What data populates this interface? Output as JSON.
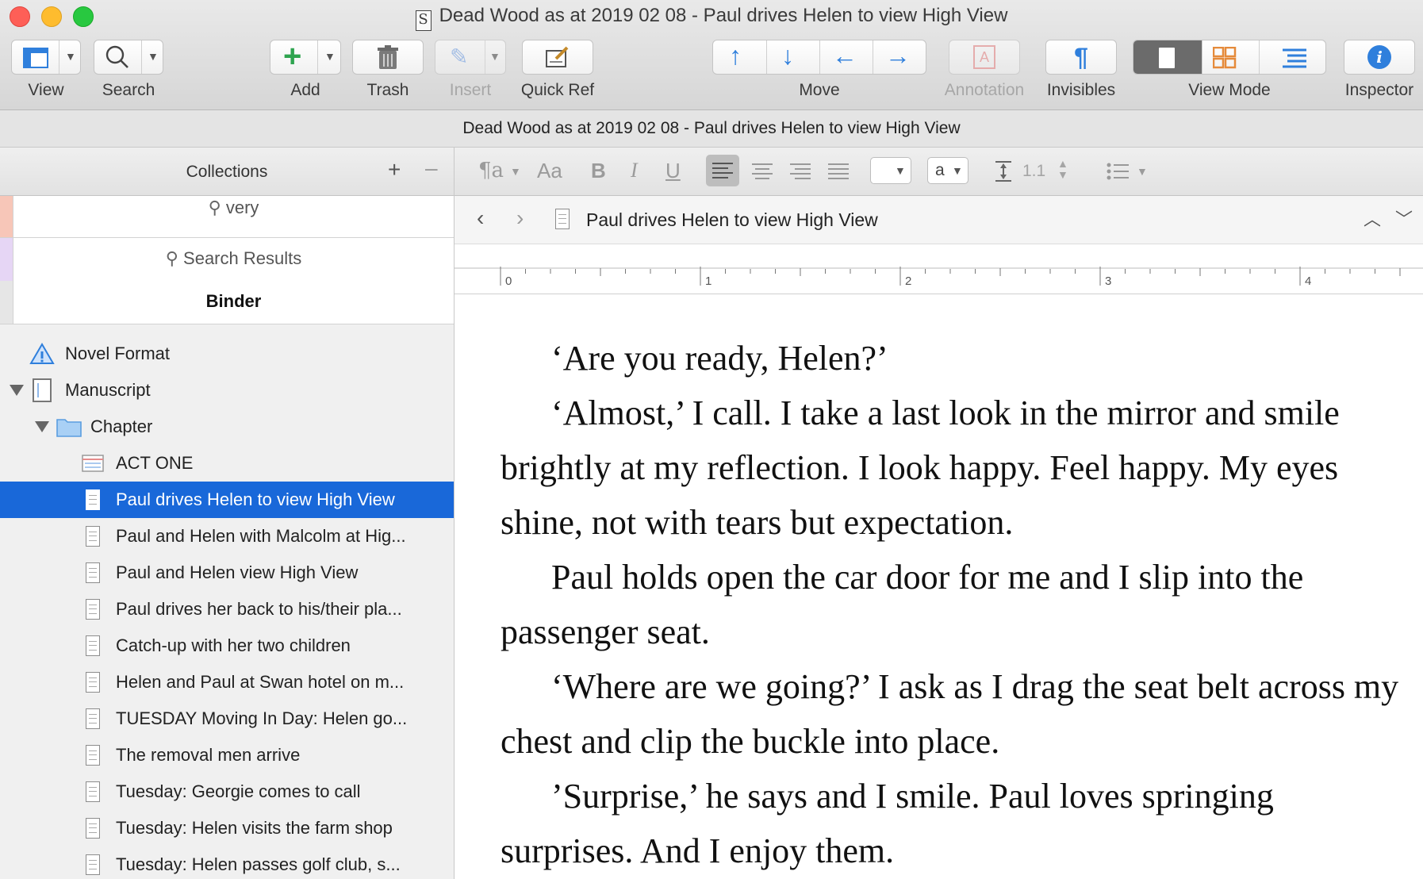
{
  "window": {
    "title": "Dead Wood as at 2019 02 08 - Paul drives Helen to view High View"
  },
  "toolbar": {
    "view": "View",
    "search": "Search",
    "add": "Add",
    "trash": "Trash",
    "insert": "Insert",
    "quick_ref": "Quick Ref",
    "move": "Move",
    "annotation": "Annotation",
    "invisibles": "Invisibles",
    "view_mode": "View Mode",
    "inspector": "Inspector"
  },
  "pathbar": {
    "text": "Dead Wood as at 2019 02 08 - Paul drives Helen to view High View"
  },
  "sidebar": {
    "collections_title": "Collections",
    "collections": [
      {
        "label": "very",
        "color": "#f7c6b8"
      },
      {
        "label": "Search Results",
        "color": "#e6d6f5"
      },
      {
        "label": "Binder",
        "color": "#e6e6e6"
      }
    ],
    "binder": [
      {
        "label": "Novel Format"
      },
      {
        "label": "Manuscript"
      },
      {
        "label": "Chapter"
      },
      {
        "label": "ACT ONE"
      },
      {
        "label": "Paul drives Helen to view High View"
      },
      {
        "label": "Paul and Helen with Malcolm at Hig..."
      },
      {
        "label": "Paul and Helen view High View"
      },
      {
        "label": "Paul drives her back to his/their pla..."
      },
      {
        "label": "Catch-up with her two children"
      },
      {
        "label": "Helen and Paul at Swan hotel on m..."
      },
      {
        "label": "TUESDAY Moving In Day: Helen go..."
      },
      {
        "label": "The removal men arrive"
      },
      {
        "label": "Tuesday: Georgie comes to call"
      },
      {
        "label": "Tuesday: Helen visits the farm shop"
      },
      {
        "label": "Tuesday: Helen passes golf club, s..."
      }
    ]
  },
  "format_bar": {
    "line_spacing": "1.1",
    "font_style_sample": "a"
  },
  "editor": {
    "doc_title": "Paul drives Helen to view High View",
    "ruler_marks": [
      "0",
      "1",
      "2",
      "3",
      "4"
    ],
    "paragraphs": [
      "‘Are you ready, Helen?’",
      "‘Almost,’ I call. I take a last look in the mirror and smile brightly at my reflection. I look happy. Feel happy. My eyes shine, not with tears but expectation.",
      "Paul holds open the car door for me and I slip into the passenger seat.",
      "‘Where are we going?’ I ask as I drag the seat belt across my chest and clip the buckle into place.",
      "’Surprise,’ he says and I smile. Paul loves springing surprises. And I enjoy them."
    ]
  }
}
